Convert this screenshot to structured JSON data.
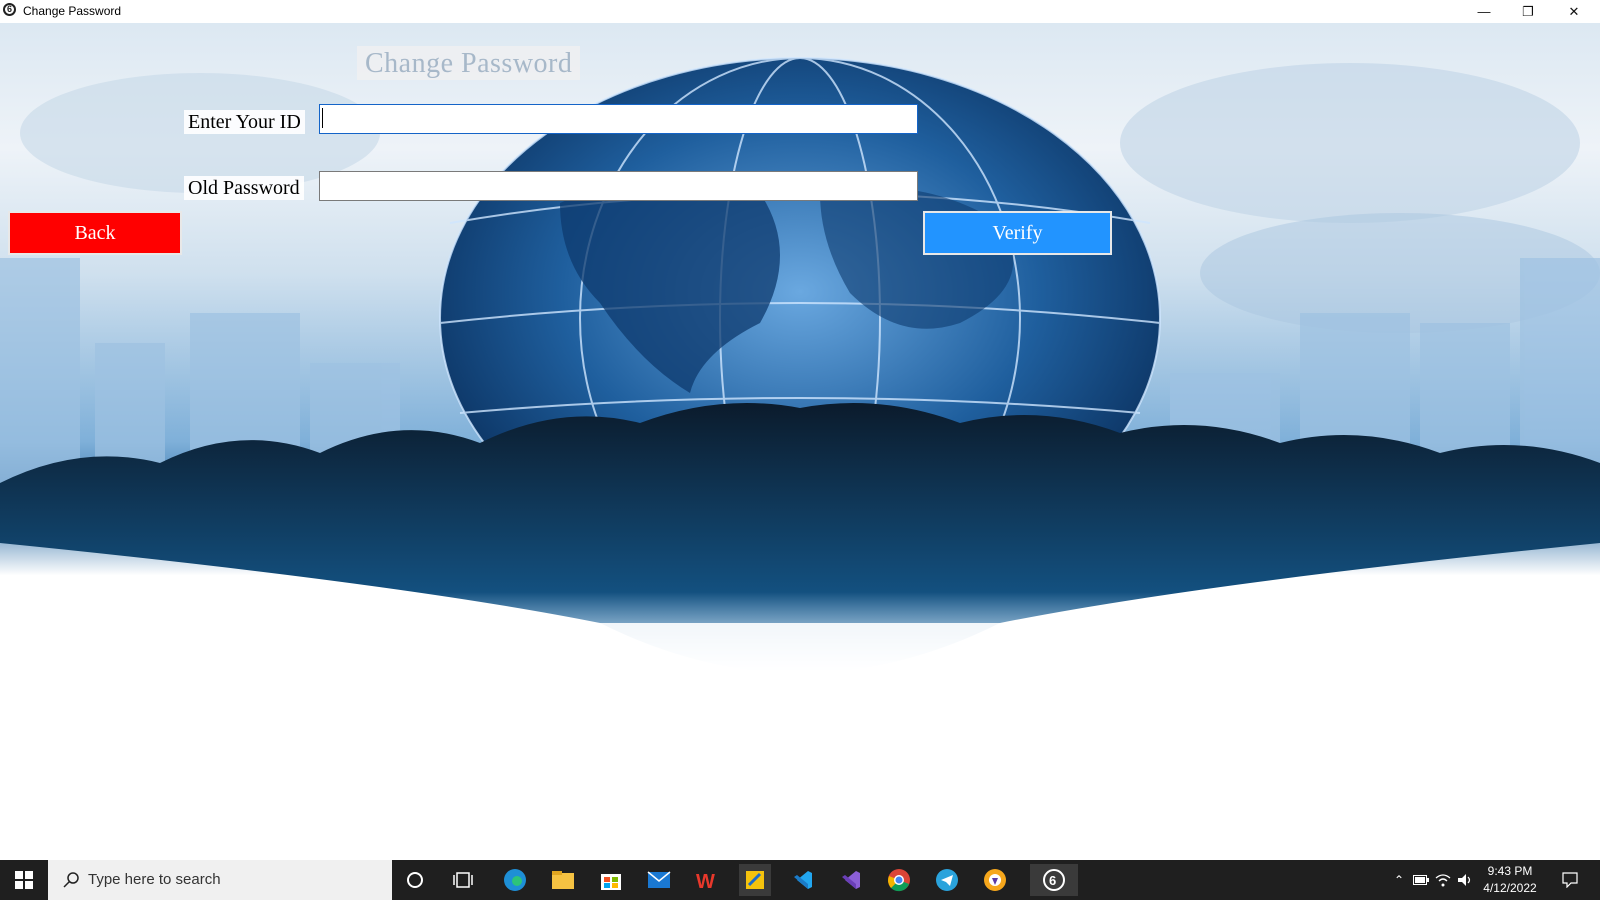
{
  "window": {
    "title": "Change Password",
    "app_icon": "lock-6-icon"
  },
  "form": {
    "heading": "Change Password",
    "id_label": "Enter Your ID",
    "id_value": "",
    "old_password_label": "Old Password",
    "old_password_value": "",
    "back_label": "Back",
    "verify_label": "Verify"
  },
  "colors": {
    "back_button": "#ff0000",
    "verify_button": "#2294ff",
    "heading_text": "#a7b8c9"
  },
  "taskbar": {
    "search_placeholder": "Type here to search",
    "time": "9:43 PM",
    "date": "4/12/2022",
    "pinned": [
      "cortana-icon",
      "task-view-icon",
      "edge-icon",
      "file-explorer-icon",
      "store-icon",
      "mail-icon",
      "wps-office-icon",
      "sql-tool-icon",
      "vscode-icon",
      "visual-studio-icon",
      "chrome-icon",
      "telegram-icon",
      "brave-icon",
      "change-password-app-icon"
    ]
  }
}
